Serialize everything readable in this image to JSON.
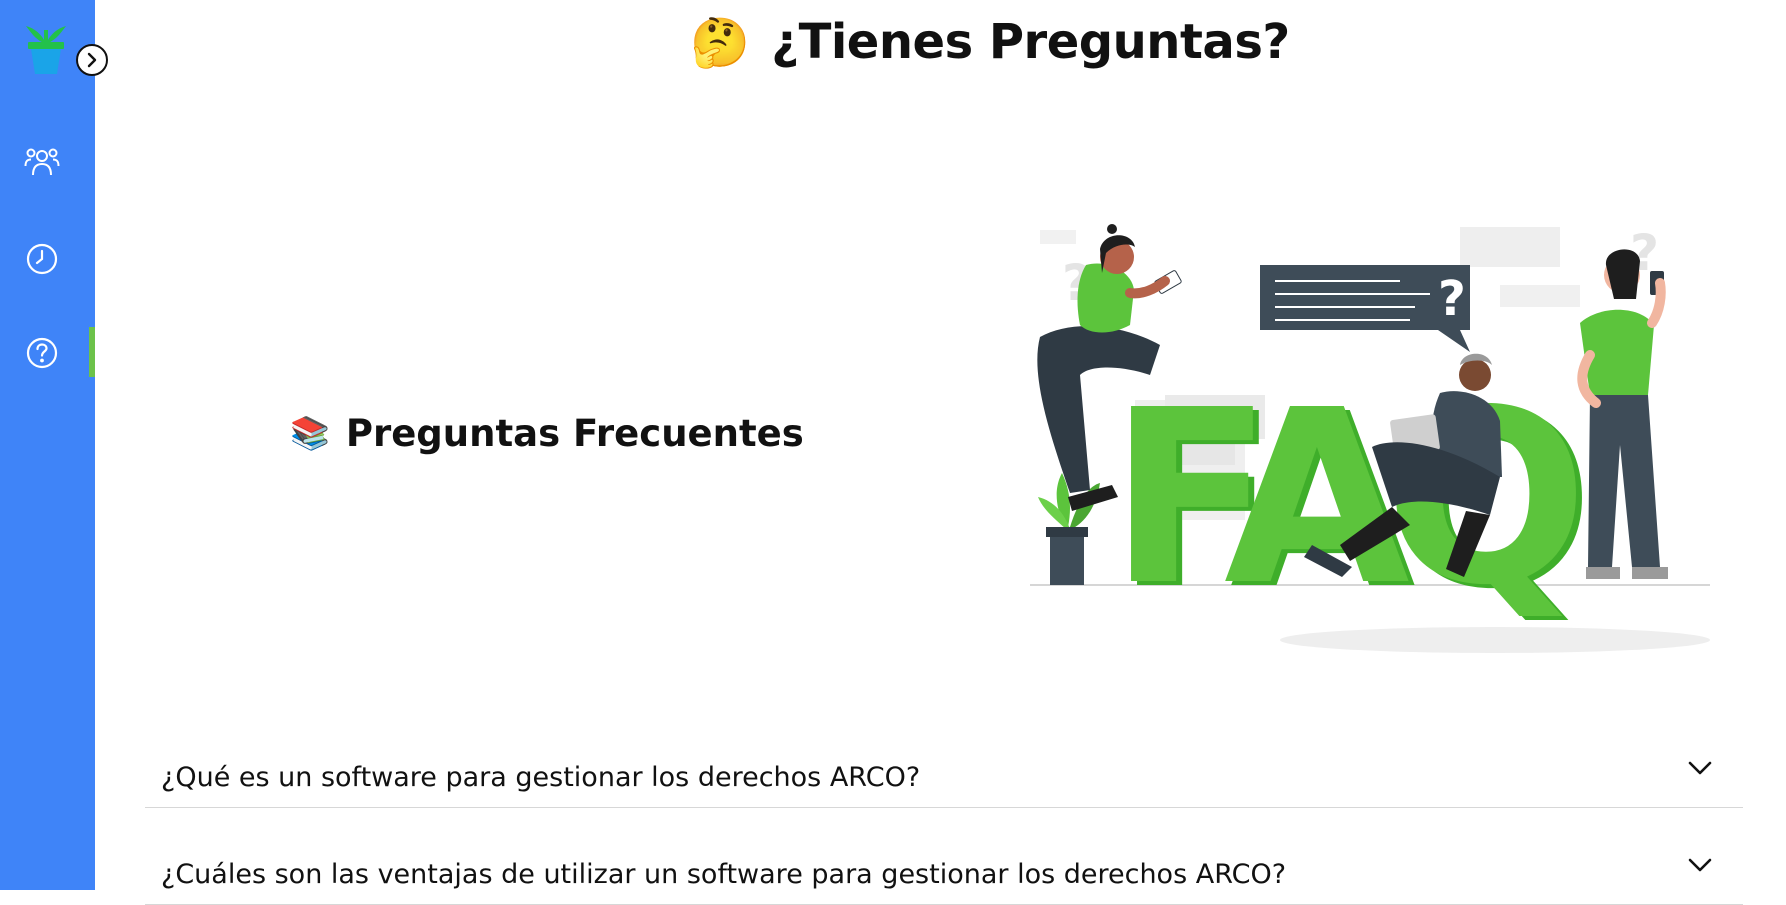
{
  "sidebar": {
    "logo_icon": "plant-pot-logo",
    "toggle_icon": "chevron-right-icon",
    "items": [
      {
        "icon": "users-icon",
        "active": false
      },
      {
        "icon": "clock-icon",
        "active": false
      },
      {
        "icon": "help-circle-icon",
        "active": true
      }
    ],
    "colors": {
      "background": "#3f84f8",
      "active_indicator": "#6cc24a"
    }
  },
  "header": {
    "emoji": "🤔",
    "title": "¿Tienes Preguntas?"
  },
  "faq_section": {
    "emoji": "📚",
    "title": "Preguntas Frecuentes",
    "illustration": "faq-illustration",
    "illustration_letters": "FAQ",
    "accent_color": "#5cc43c",
    "items": [
      {
        "question": "¿Qué es un software para gestionar los derechos ARCO?",
        "expanded": false
      },
      {
        "question": "¿Cuáles son las ventajas de utilizar un software para gestionar los derechos ARCO?",
        "expanded": false
      }
    ]
  }
}
